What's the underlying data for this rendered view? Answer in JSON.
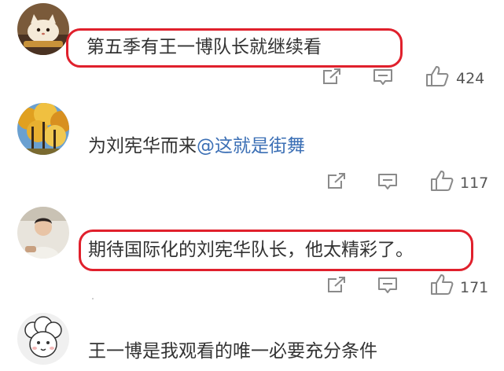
{
  "comments": [
    {
      "text": "第五季有王一博队长就继续看",
      "likes": "424",
      "highlighted": true,
      "avatar": "cat-bread-avatar"
    },
    {
      "text": "为刘宪华而来",
      "mention": "@这就是街舞",
      "likes": "117",
      "highlighted": false,
      "avatar": "autumn-trees-avatar"
    },
    {
      "text": "期待国际化的刘宪华队长，他太精彩了。",
      "likes": "171",
      "highlighted": true,
      "avatar": "person-photo-avatar"
    },
    {
      "text": "王一博是我观看的唯一必要充分条件",
      "highlighted": false,
      "avatar": "sheep-cartoon-avatar"
    }
  ],
  "colors": {
    "highlight_border": "#e0202c",
    "mention": "#3b6fb5",
    "icon": "#8a8a8a",
    "text": "#333333"
  },
  "icons": {
    "share": "share-icon",
    "comment": "comment-icon",
    "like": "thumbs-up-icon"
  }
}
